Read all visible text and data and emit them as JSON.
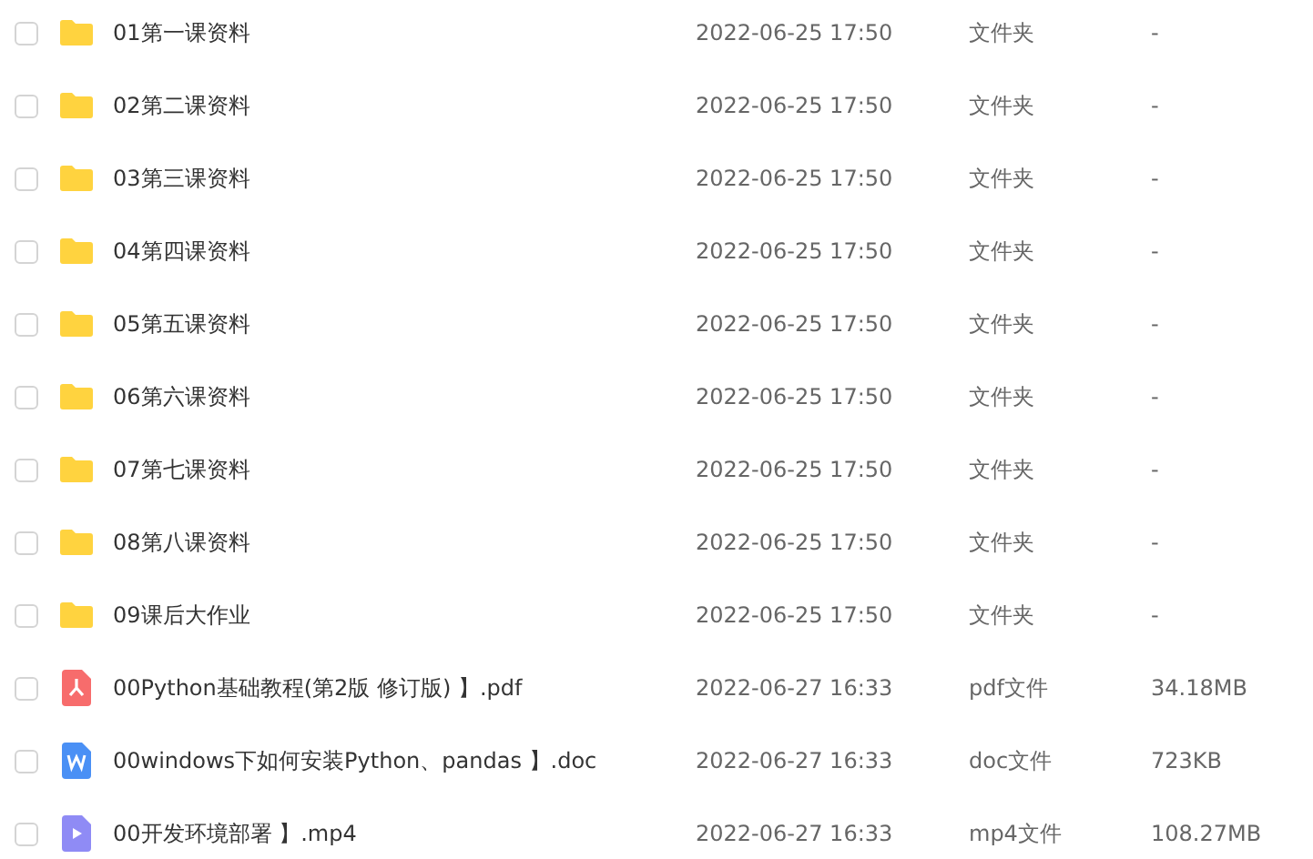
{
  "files": [
    {
      "kind": "folder",
      "name": "01第一课资料",
      "modified": "2022-06-25 17:50",
      "type": "文件夹",
      "size": "-",
      "checked": false
    },
    {
      "kind": "folder",
      "name": "02第二课资料",
      "modified": "2022-06-25 17:50",
      "type": "文件夹",
      "size": "-",
      "checked": false
    },
    {
      "kind": "folder",
      "name": "03第三课资料",
      "modified": "2022-06-25 17:50",
      "type": "文件夹",
      "size": "-",
      "checked": false
    },
    {
      "kind": "folder",
      "name": "04第四课资料",
      "modified": "2022-06-25 17:50",
      "type": "文件夹",
      "size": "-",
      "checked": false
    },
    {
      "kind": "folder",
      "name": "05第五课资料",
      "modified": "2022-06-25 17:50",
      "type": "文件夹",
      "size": "-",
      "checked": false
    },
    {
      "kind": "folder",
      "name": "06第六课资料",
      "modified": "2022-06-25 17:50",
      "type": "文件夹",
      "size": "-",
      "checked": false
    },
    {
      "kind": "folder",
      "name": "07第七课资料",
      "modified": "2022-06-25 17:50",
      "type": "文件夹",
      "size": "-",
      "checked": false
    },
    {
      "kind": "folder",
      "name": "08第八课资料",
      "modified": "2022-06-25 17:50",
      "type": "文件夹",
      "size": "-",
      "checked": false
    },
    {
      "kind": "folder",
      "name": "09课后大作业",
      "modified": "2022-06-25 17:50",
      "type": "文件夹",
      "size": "-",
      "checked": false
    },
    {
      "kind": "pdf",
      "name": "00Python基础教程(第2版 修订版) 】.pdf",
      "modified": "2022-06-27 16:33",
      "type": "pdf文件",
      "size": "34.18MB",
      "checked": false
    },
    {
      "kind": "doc",
      "name": "00windows下如何安装Python、pandas 】.doc",
      "modified": "2022-06-27 16:33",
      "type": "doc文件",
      "size": "723KB",
      "checked": false
    },
    {
      "kind": "video",
      "name": "00开发环境部署 】.mp4",
      "modified": "2022-06-27 16:33",
      "type": "mp4文件",
      "size": "108.27MB",
      "checked": false
    }
  ]
}
